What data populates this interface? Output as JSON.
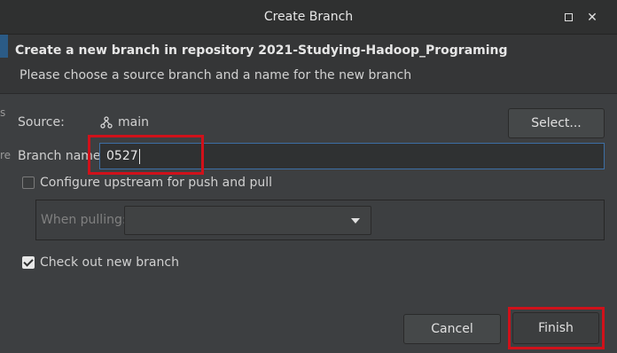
{
  "window": {
    "title": "Create Branch"
  },
  "header": {
    "title": "Create a new branch in repository 2021-Studying-Hadoop_Programing",
    "message": "Please choose a source branch and a name for the new branch"
  },
  "form": {
    "source_label": "Source:",
    "source_value": "main",
    "select_button": "Select...",
    "branch_name_label": "Branch name:",
    "branch_name_value": "0527",
    "configure_upstream_label": "Configure upstream for push and pull",
    "configure_upstream_checked": false,
    "when_pulling_label": "When pulling:",
    "when_pulling_value": "",
    "checkout_label": "Check out new branch",
    "checkout_checked": true
  },
  "buttons": {
    "cancel": "Cancel",
    "finish": "Finish"
  },
  "background_fragments": {
    "left_1": "s",
    "left_2": "re"
  },
  "colors": {
    "highlight": "#d0111a",
    "focus": "#3d6fa5"
  }
}
